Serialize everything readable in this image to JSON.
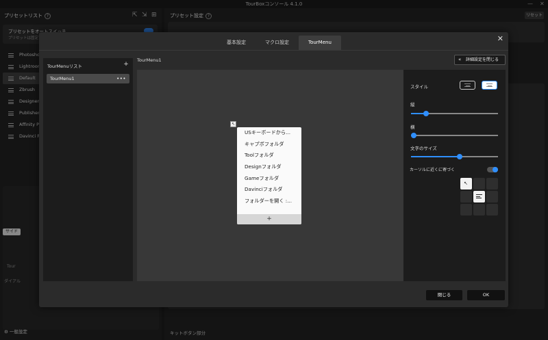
{
  "window": {
    "title": "TourBoxコンソール 4.1.0",
    "minimize": "—",
    "close": "✕"
  },
  "left_pane": {
    "heading": "プリセットリスト",
    "auto_switch": {
      "title": "プリセットをオートスイッチ",
      "subtitle": "プリセットは固定ア"
    },
    "presets": [
      "Photoshop",
      "Lightroom",
      "Default",
      "Zbrush",
      "Designer",
      "Publisher",
      "Affinity Ph",
      "Davinci Re"
    ],
    "selected_preset": "Default",
    "side_chip": "サイド",
    "tour_label": "Tour",
    "dial_label": "ダイアル",
    "footer": "一般設定"
  },
  "right_pane": {
    "heading": "プリセット設定",
    "reset": "リセット",
    "footer": "キットボタン部分"
  },
  "modal": {
    "tabs": [
      "基本設定",
      "マクロ設定",
      "TourMenu"
    ],
    "active_tab": "TourMenu",
    "close": "✕",
    "menu_list": {
      "title": "TourMenuリスト",
      "add": "+",
      "items": [
        "TourMenu1"
      ],
      "more": "•••"
    },
    "editor_title": "TourMenu1",
    "advanced_button": "詳細設定を閉じる",
    "advanced_chevron": "«",
    "preview_menu": {
      "items": [
        "USキーボードから...",
        "キャプボフォルダ",
        "Toolフォルダ",
        "Designフォルダ",
        "Gameフォルダ",
        "Davinciフォルダ",
        "フォルダーを開く :..."
      ],
      "add": "+"
    },
    "settings": {
      "style_label": "スタイル",
      "height_label": "縦",
      "height_value": 0.17,
      "width_label": "横",
      "width_value": 0.03,
      "font_size_label": "文字のサイズ",
      "font_size_value": 0.56,
      "follow_cursor_label": "カーソルに近くに寄づく",
      "follow_cursor_on": true,
      "position_grid_selected": 0,
      "accent_color": "#2f8fff"
    },
    "buttons": {
      "cancel": "閉じる",
      "ok": "OK"
    }
  }
}
